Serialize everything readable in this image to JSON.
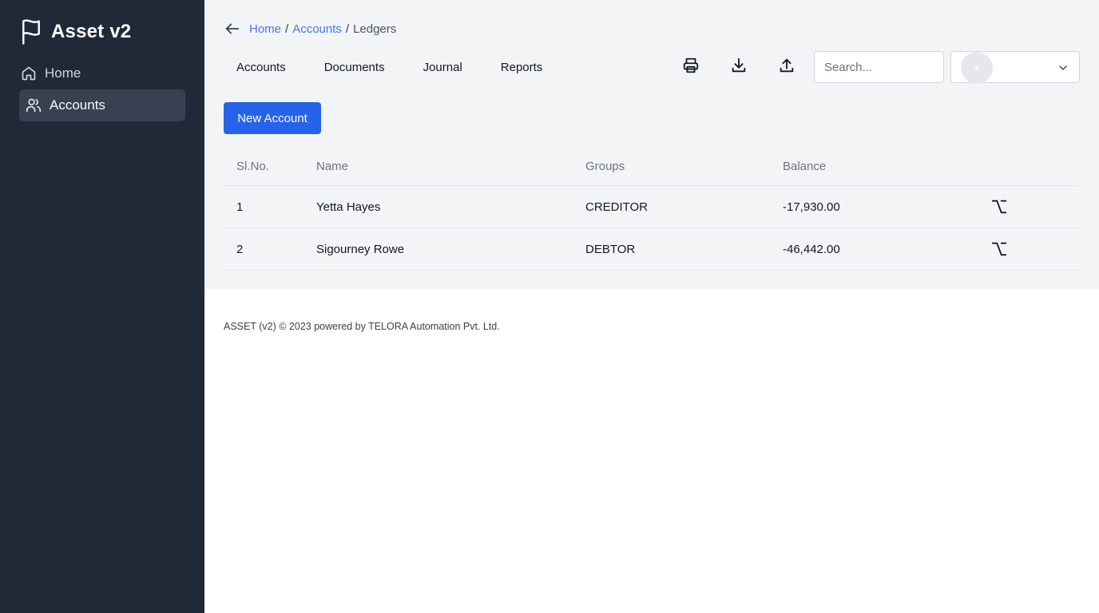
{
  "app": {
    "title": "Asset v2"
  },
  "sidebar": {
    "items": [
      {
        "label": "Home",
        "icon": "home-icon"
      },
      {
        "label": "Accounts",
        "icon": "users-icon",
        "active": true
      }
    ]
  },
  "breadcrumb": {
    "items": [
      "Home",
      "Accounts",
      "Ledgers"
    ],
    "separator": "/"
  },
  "tabs": [
    "Accounts",
    "Documents",
    "Journal",
    "Reports"
  ],
  "toolbar": {
    "icons": [
      "printer-icon",
      "download-icon",
      "upload-icon"
    ],
    "search_placeholder": "Search...",
    "select_value": ""
  },
  "actions": {
    "new_account": "New Account"
  },
  "table": {
    "columns": [
      "Sl.No.",
      "Name",
      "Groups",
      "Balance",
      ""
    ],
    "rows": [
      {
        "sl": "1",
        "name": "Yetta Hayes",
        "group": "CREDITOR",
        "balance": "-17,930.00",
        "action_icon": "option-key-icon"
      },
      {
        "sl": "2",
        "name": "Sigourney Rowe",
        "group": "DEBTOR",
        "balance": "-46,442.00",
        "action_icon": "option-key-icon"
      }
    ]
  },
  "footer": {
    "text": "ASSET (v2) © 2023 powered by TELORA Automation Pvt. Ltd."
  },
  "colors": {
    "sidebar_bg": "#1f2937",
    "sidebar_active": "#374151",
    "content_bg": "#f3f4f6",
    "primary": "#2563eb",
    "link": "#2563eb"
  }
}
